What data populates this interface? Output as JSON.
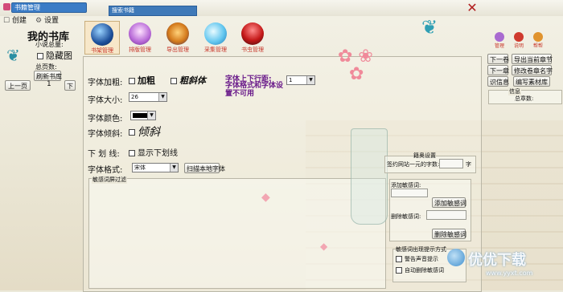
{
  "window": {
    "title": "书籍管理",
    "search_placeholder": "搜索书籍"
  },
  "sidebar": {
    "create_label": "创建",
    "settings_label": "设置",
    "shelf_title": "我的书库",
    "novel_total_label": "小说总量:",
    "hide_label": "隐藏图",
    "total_pages_label": "总页数:",
    "refresh_label": "刷新书库",
    "prev_page_label": "上一页",
    "next_page_label": "下",
    "page_number": "1"
  },
  "toolbar": {
    "tabs": [
      {
        "label": "书架管理",
        "icon": "crystal-ball-icon"
      },
      {
        "label": "排版管理",
        "icon": "purple-orb-icon"
      },
      {
        "label": "导出管理",
        "icon": "lantern-icon"
      },
      {
        "label": "采集管理",
        "icon": "cloud-icon"
      },
      {
        "label": "书虫管理",
        "icon": "mushroom-icon"
      }
    ]
  },
  "font_settings": {
    "bold_label": "字体加粗:",
    "bold_option": "加粗",
    "italic_option": "粗斜体",
    "line_spacing_label": "字体上下行距:",
    "line_spacing_value": "1",
    "warning_text": "字体格式和字体设置不可用",
    "size_label": "字体大小:",
    "size_value": "26",
    "color_label": "字体颜色:",
    "slant_label": "字体倾斜:",
    "slant_preview": "倾斜",
    "underline_label": "下 划 线:",
    "underline_option": "显示下划线",
    "format_label": "字体格式:",
    "format_value": "宋体",
    "scan_fonts_label": "扫描本地字体",
    "sensitive_filter_label": "敏感词屏过滤"
  },
  "right_panel": {
    "top_icons": [
      {
        "label": "管理",
        "icon": "purple-icon"
      },
      {
        "label": "说明",
        "icon": "red-icon"
      },
      {
        "label": "帮帮",
        "icon": "lantern-icon-small"
      }
    ],
    "prev_chapter_label": "下一卷",
    "export_label": "导出当前章节",
    "next_chapter_label": "下一章",
    "edit_chapter_label": "修改卷章名字",
    "info_label": "识信息",
    "write_material_label": "编写素材库",
    "info_title": "信息",
    "word_count_label": "总章数:",
    "settings_title": "籍奥设置",
    "site_words_label": "签约网站一元的字数:",
    "site_words_unit": "字",
    "add_sensitive_label": "添加敏感词:",
    "add_sensitive_button": "添加敏感词",
    "delete_sensitive_label": "删除敏感词:",
    "delete_sensitive_button": "删除敏感词",
    "prompt_title": "敏感词出现提示方式",
    "sound_prompt_label": "警告声音提示",
    "auto_delete_label": "自动删除敏感词"
  },
  "watermark": {
    "brand": "优优下载",
    "url": "www.yyxt.com"
  },
  "colors": {
    "accent_red": "#c8372a",
    "warning_purple": "#6a1b8a",
    "panel_border": "#b9b6a6"
  }
}
